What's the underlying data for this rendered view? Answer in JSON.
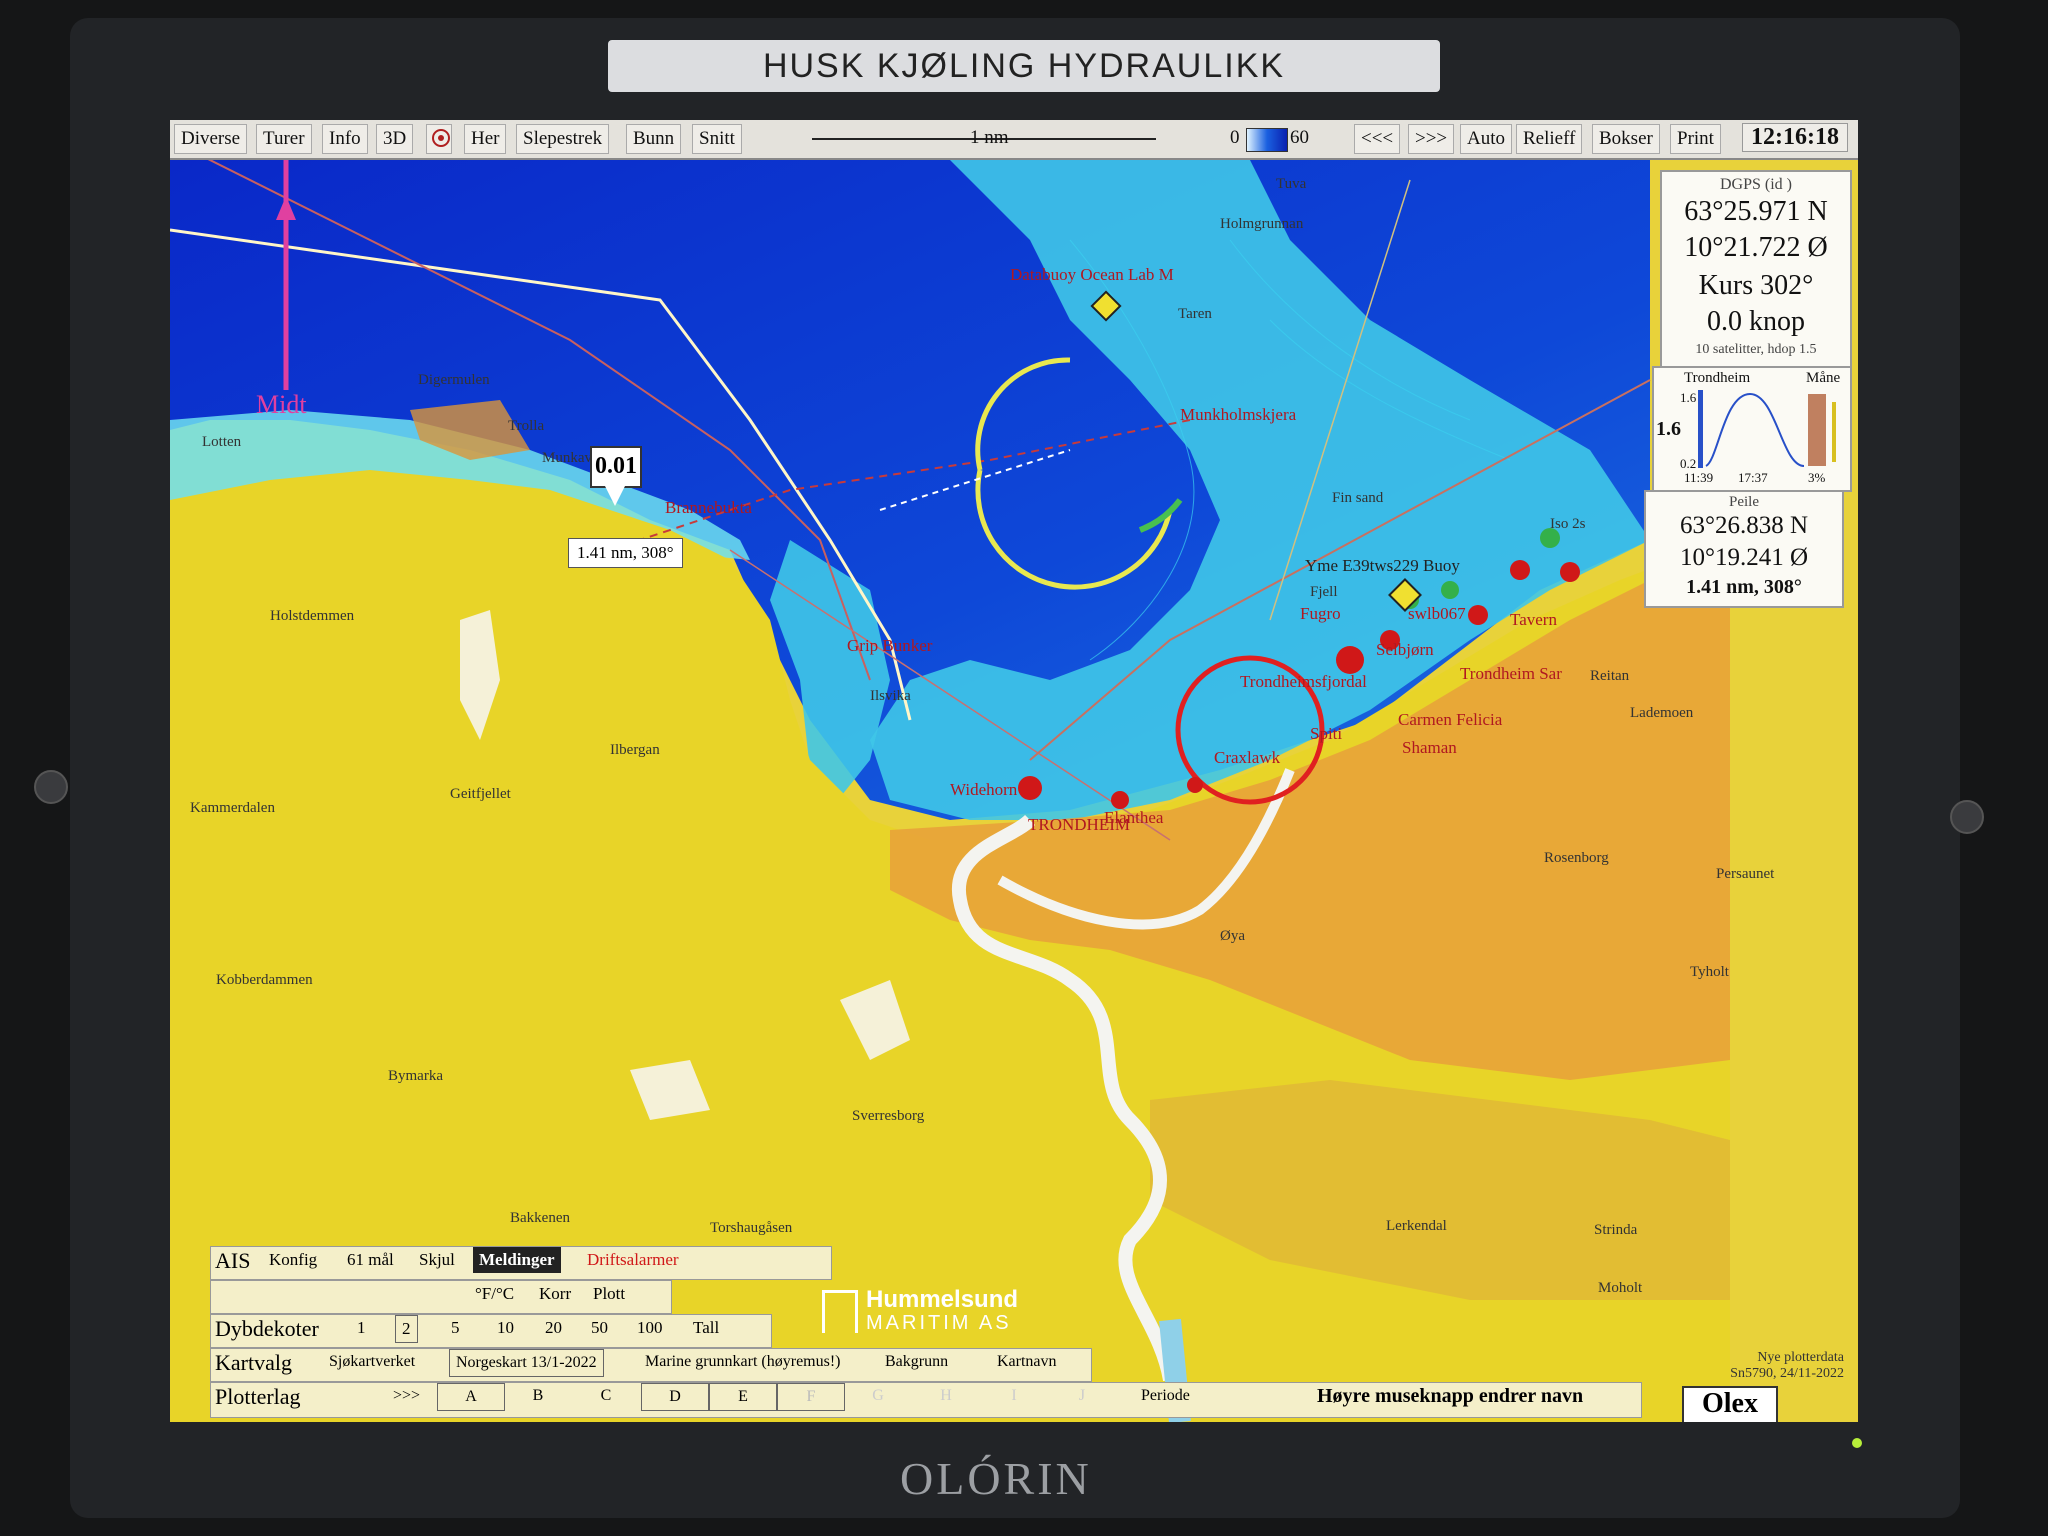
{
  "monitor": {
    "label_strip": "HUSK KJØLING HYDRAULIKK",
    "brand": "OLÓRIN"
  },
  "toolbar": {
    "left_items": [
      "Diverse",
      "Turer",
      "Info",
      "3D"
    ],
    "target_icon": "target-icon",
    "mid_items": [
      "Her",
      "Slepestrek",
      "Bunn",
      "Snitt"
    ],
    "scale_label": "1 nm",
    "depth_min": "0",
    "depth_max": "60",
    "right_items": [
      "<<<",
      ">>>",
      "Auto",
      "Relieff",
      "Bokser",
      "Print"
    ],
    "clock": "12:16:18"
  },
  "gps_panel": {
    "source": "DGPS (id )",
    "lat": "63°25.971 N",
    "lon": "10°21.722 Ø",
    "course": "Kurs 302°",
    "speed": "0.0 knop",
    "satellites": "10 satelitter, hdop 1.5"
  },
  "tide_panel": {
    "place": "Trondheim",
    "moon_label": "Måne",
    "level_top": "1.6",
    "level_current": "1.6",
    "level_bottom": "0.2",
    "time1": "11:39",
    "time2": "17:37",
    "moon_pct": "3%"
  },
  "bearing_panel": {
    "title": "Peile",
    "lat": "63°26.838 N",
    "lon": "10°19.241 Ø",
    "dist": "1.41 nm, 308°"
  },
  "map": {
    "marker_value": "0.01",
    "cursor_readout": "1.41 nm, 308°",
    "north_label": "Midt",
    "place_labels_red": [
      "Databuoy Ocean Lab M",
      "Munkholmskjera",
      "Brannebukta",
      "Grip Bunker",
      "Selbjørn",
      "Trondheim Sar",
      "Carmen Felicia",
      "Spiti",
      "Shaman",
      "Yme E39tws229 Buoy",
      "Fugro",
      "swlb067",
      "TRONDHEIM",
      "Elanthea",
      "Craxlawk",
      "Trondheimsfjordal",
      "Tavern",
      "Widehorn"
    ],
    "place_labels_dark": [
      "Tuva",
      "Holmgrunnan",
      "Taren",
      "Lotten",
      "Digermulen",
      "Trolla",
      "Munkav",
      "Holstdemmen",
      "Ilsvika",
      "Ilbergan",
      "Geitfjellet",
      "Kammerdalen",
      "Kobberdammen",
      "Bymarka",
      "Sverresborg",
      "Bakkenen",
      "Torshaugåsen",
      "Øya",
      "Rosenborg",
      "Lademoen",
      "Reitan",
      "Persaunet",
      "Tyholt",
      "Lerkendal",
      "Strinda",
      "Moholt",
      "Fjell",
      "Fin sand",
      "Iso 2s"
    ]
  },
  "ais_row": {
    "label": "AIS",
    "items": [
      "Konfig",
      "61 mål",
      "Skjul"
    ],
    "active": "Meldinger",
    "alarm": "Driftsalarmer"
  },
  "temp_row": {
    "items": [
      "°F/°C",
      "Korr",
      "Plott"
    ]
  },
  "depth_row": {
    "label": "Dybdekoter",
    "values": [
      "1",
      "2",
      "5",
      "10",
      "20",
      "50",
      "100",
      "Tall"
    ]
  },
  "chart_row": {
    "label": "Kartvalg",
    "items": [
      "Sjøkartverket",
      "Norgeskart 13/1-2022",
      "Marine grunnkart (høyremus!)",
      "Bakgrunn",
      "Kartnavn"
    ]
  },
  "layer_row": {
    "label": "Plotterlag",
    "more": ">>>",
    "layers": [
      "A",
      "B",
      "C",
      "D",
      "E",
      "F",
      "G",
      "H",
      "I",
      "J"
    ],
    "periode": "Periode",
    "hint": "Høyre museknapp endrer navn"
  },
  "footer": {
    "plotter_note_1": "Nye plotterdata",
    "plotter_note_2": "Sn5790, 24/11-2022",
    "logo": "Olex"
  },
  "watermark": {
    "line1": "Hummelsund",
    "line2": "MARITIM AS"
  }
}
